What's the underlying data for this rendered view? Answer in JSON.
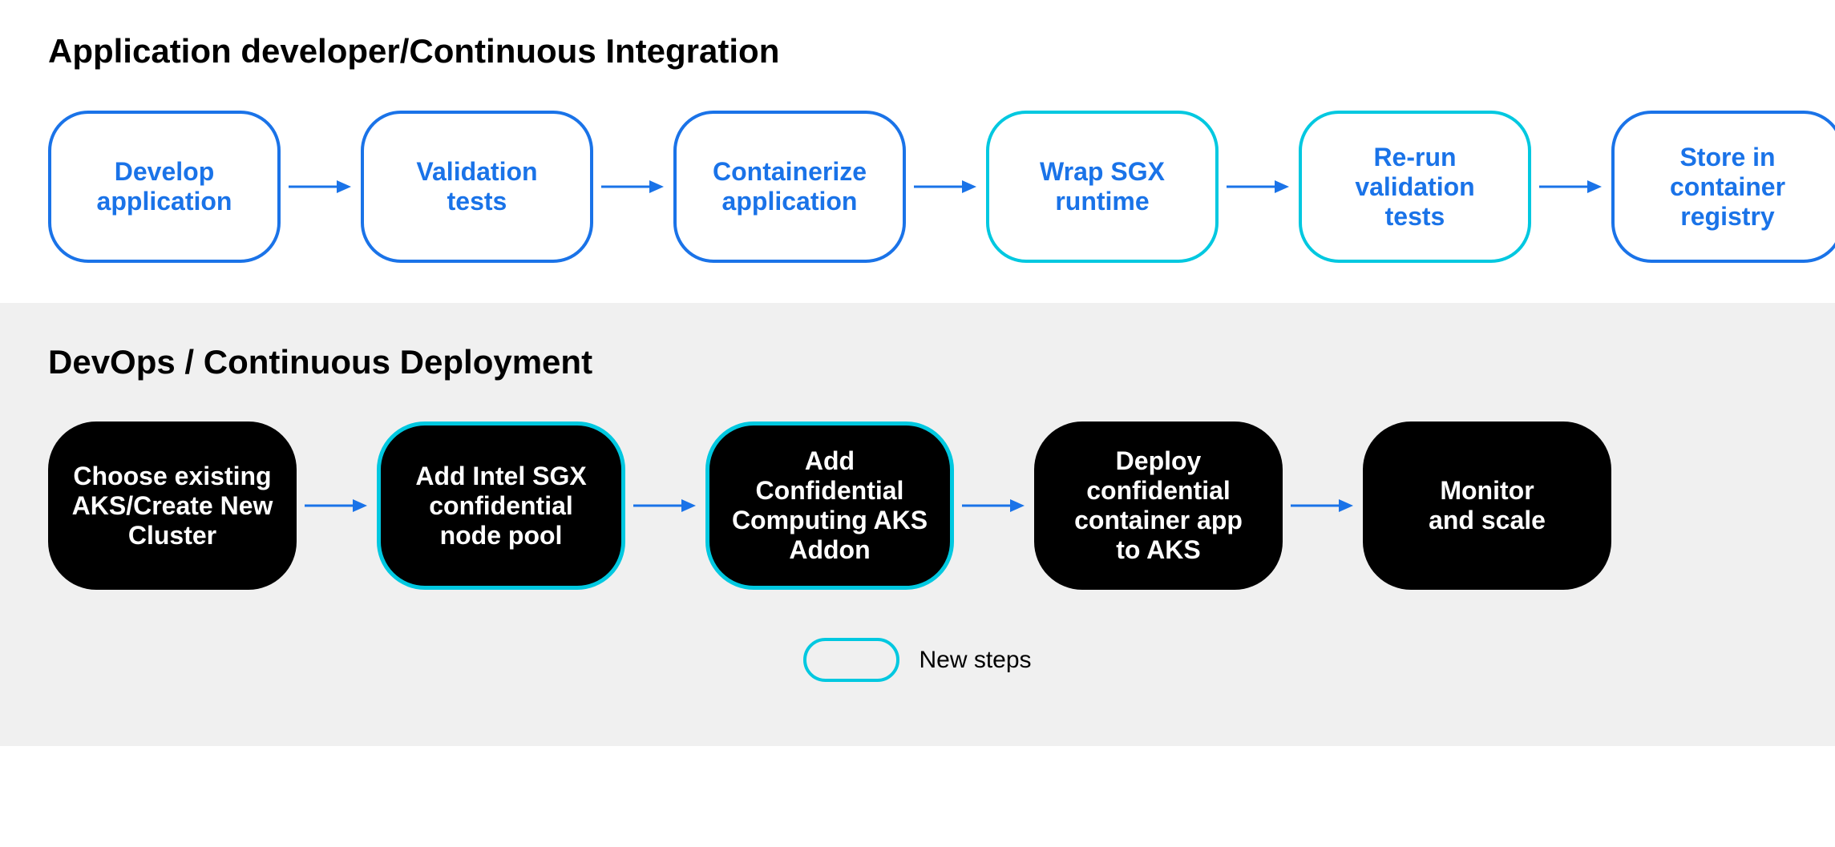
{
  "top_section": {
    "title": "Application developer/Continuous Integration",
    "nodes": [
      {
        "id": "develop-app",
        "label": "Develop\napplication",
        "highlight": false
      },
      {
        "id": "validation-tests",
        "label": "Validation\ntests",
        "highlight": false
      },
      {
        "id": "containerize-app",
        "label": "Containerize\napplication",
        "highlight": false
      },
      {
        "id": "wrap-sgx",
        "label": "Wrap SGX\nruntime",
        "highlight": true
      },
      {
        "id": "rerun-validation",
        "label": "Re-run\nvalidation\ntests",
        "highlight": true
      },
      {
        "id": "store-registry",
        "label": "Store in\ncontainer\nregistry",
        "highlight": false
      }
    ]
  },
  "bottom_section": {
    "title": "DevOps / Continuous Deployment",
    "nodes": [
      {
        "id": "choose-aks",
        "label": "Choose existing\nAKS/Create New\nCluster",
        "highlight": false
      },
      {
        "id": "add-intel-sgx",
        "label": "Add Intel SGX\nconfidential\nnode pool",
        "highlight": true
      },
      {
        "id": "add-cc-addon",
        "label": "Add\nConfidential\nComputing AKS\nAddon",
        "highlight": true
      },
      {
        "id": "deploy-confidential",
        "label": "Deploy\nconfidential\ncontainer app\nto AKS",
        "highlight": false
      },
      {
        "id": "monitor-scale",
        "label": "Monitor\nand scale",
        "highlight": false
      }
    ],
    "legend_label": "New steps"
  }
}
